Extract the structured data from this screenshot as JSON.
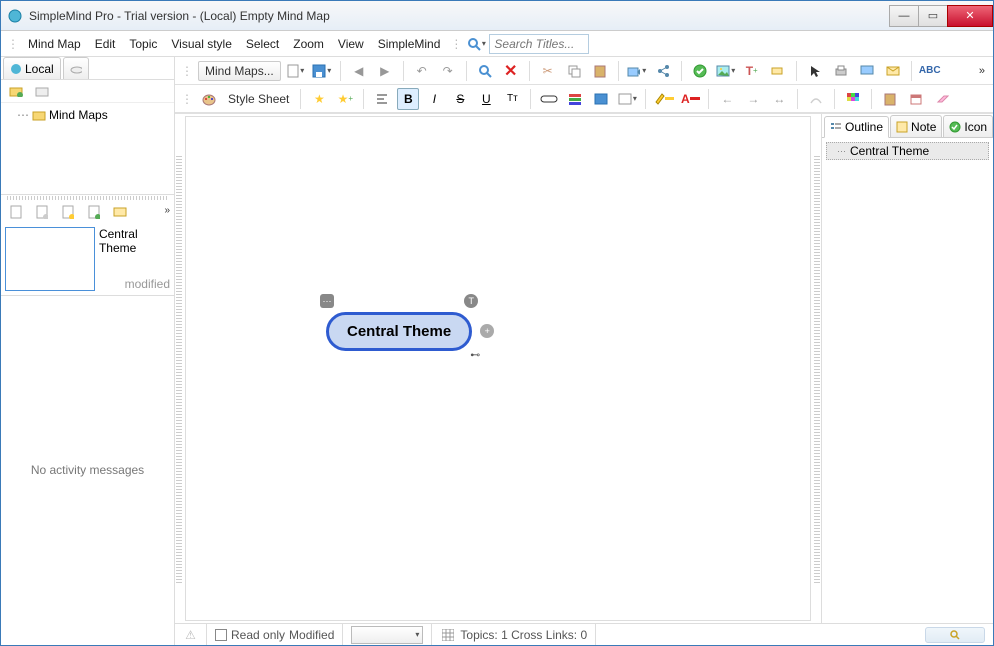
{
  "window": {
    "title": "SimpleMind Pro - Trial version - (Local) Empty Mind Map"
  },
  "menus": {
    "mindmap": "Mind Map",
    "edit": "Edit",
    "topic": "Topic",
    "visual": "Visual style",
    "select": "Select",
    "zoom": "Zoom",
    "view": "View",
    "simplemind": "SimpleMind"
  },
  "search": {
    "placeholder": "Search Titles..."
  },
  "left": {
    "local_tab": "Local",
    "mindmaps_folder": "Mind Maps"
  },
  "thumb": {
    "title": "Central Theme",
    "status": "modified"
  },
  "toolbar2": {
    "mindmaps_btn": "Mind Maps..."
  },
  "toolbar3": {
    "stylesheet": "Style Sheet",
    "bold": "B",
    "italic": "I",
    "strike": "S",
    "underline": "U",
    "tt": "Tт",
    "text_a": "A"
  },
  "canvas": {
    "central": "Central Theme"
  },
  "right": {
    "outline_tab": "Outline",
    "note_tab": "Note",
    "icon_tab": "Icon",
    "outline_item": "Central Theme"
  },
  "status": {
    "activity": "No activity messages",
    "readonly": "Read only",
    "modified": "Modified",
    "counts": "Topics: 1  Cross Links: 0"
  }
}
